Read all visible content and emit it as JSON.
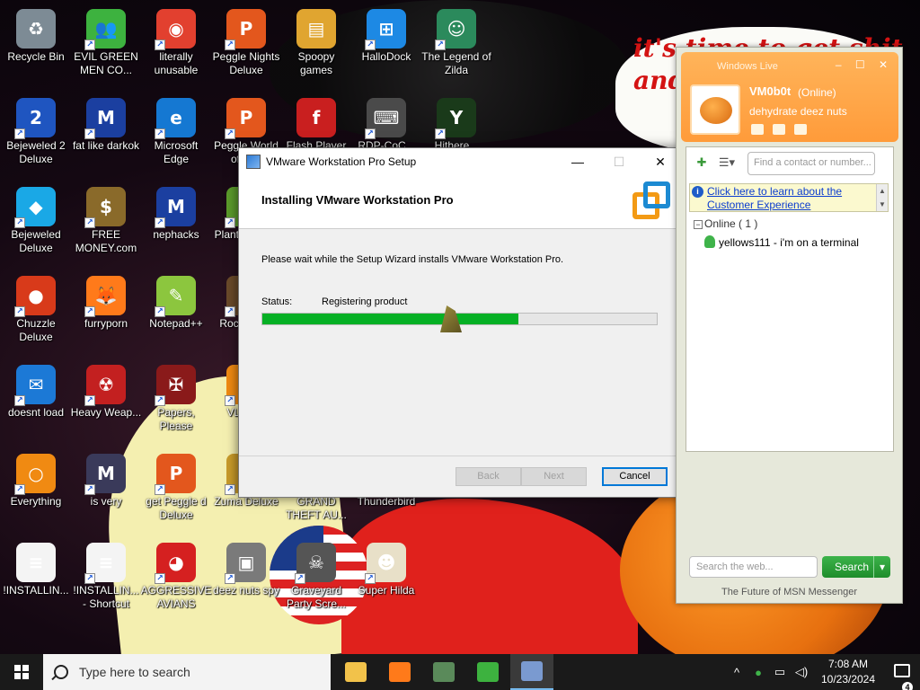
{
  "wallpaper": {
    "speech_text": "it's time to get shit and ... or t..."
  },
  "desktop_icons": [
    {
      "name": "recycle-bin-icon",
      "label": "Recycle Bin",
      "color": "#7d8b95",
      "glyph": "♻",
      "shortcut": false
    },
    {
      "name": "evil-green-men-icon",
      "label": "EVIL GREEN MEN CO...",
      "color": "#3db23f",
      "glyph": "👥",
      "shortcut": true
    },
    {
      "name": "chrome-icon",
      "label": "literally unusable",
      "color": "#e2402f",
      "glyph": "◉",
      "shortcut": true
    },
    {
      "name": "peggle-nights-icon",
      "label": "Peggle Nights Deluxe",
      "color": "#e3571d",
      "glyph": "P",
      "shortcut": true
    },
    {
      "name": "spoopy-games-icon",
      "label": "Spoopy games",
      "color": "#e0a530",
      "glyph": "▤",
      "shortcut": false
    },
    {
      "name": "hallodock-icon",
      "label": "HalloDock",
      "color": "#1d89e4",
      "glyph": "⊞",
      "shortcut": true
    },
    {
      "name": "zelda-icon",
      "label": "The Legend of Zilda",
      "color": "#2b8a5c",
      "glyph": "☺",
      "shortcut": true
    },
    {
      "name": "bejeweled2-icon",
      "label": "Bejeweled 2 Deluxe",
      "color": "#1f55c0",
      "glyph": "2",
      "shortcut": true
    },
    {
      "name": "mpl-icon",
      "label": "fat like darkok",
      "color": "#1b3fa0",
      "glyph": "M",
      "shortcut": true
    },
    {
      "name": "edge-icon",
      "label": "Microsoft Edge",
      "color": "#1578d2",
      "glyph": "e",
      "shortcut": true
    },
    {
      "name": "peggle-world-icon",
      "label": "Peggle World of W...",
      "color": "#e3571d",
      "glyph": "P",
      "shortcut": true
    },
    {
      "name": "flash-icon",
      "label": "Flash Player",
      "color": "#c91f1f",
      "glyph": "f",
      "shortcut": false
    },
    {
      "name": "rdp-icon",
      "label": "RDP-CoC...",
      "color": "#4a4a4a",
      "glyph": "⌨",
      "shortcut": true
    },
    {
      "name": "yashma-icon",
      "label": "Hithere...",
      "color": "#1a3a1a",
      "glyph": "Y",
      "shortcut": true
    },
    {
      "name": "bejeweled-icon",
      "label": "Bejeweled Deluxe",
      "color": "#1aa8e6",
      "glyph": "◆",
      "shortcut": true
    },
    {
      "name": "free-money-icon",
      "label": "FREE MONEY.com",
      "color": "#8a6a2a",
      "glyph": "$",
      "shortcut": true
    },
    {
      "name": "nephacks-icon",
      "label": "nephacks",
      "color": "#1b3fa0",
      "glyph": "M",
      "shortcut": true
    },
    {
      "name": "plants-zombies-icon",
      "label": "Plants Zom...",
      "color": "#5b9b2b",
      "glyph": "✿",
      "shortcut": true
    },
    {
      "name": "chuzzle-icon",
      "label": "Chuzzle Deluxe",
      "color": "#d83a1a",
      "glyph": "●",
      "shortcut": true
    },
    {
      "name": "firefox-icon",
      "label": "furryporn",
      "color": "#ff7a1a",
      "glyph": "🦊",
      "shortcut": true
    },
    {
      "name": "notepadpp-icon",
      "label": "Notepad++",
      "color": "#8cc63e",
      "glyph": "✎",
      "shortcut": true
    },
    {
      "name": "rocket-icon",
      "label": "Rock... D...",
      "color": "#6a4a2a",
      "glyph": "▲",
      "shortcut": true
    },
    {
      "name": "thunderbird-blue-icon",
      "label": "doesnt load",
      "color": "#1c79d6",
      "glyph": "✉",
      "shortcut": true
    },
    {
      "name": "heavy-weapon-icon",
      "label": "Heavy Weap...",
      "color": "#c32020",
      "glyph": "☢",
      "shortcut": true
    },
    {
      "name": "papers-please-icon",
      "label": "Papers, Please",
      "color": "#8a1a1a",
      "glyph": "✠",
      "shortcut": true
    },
    {
      "name": "vlc-icon",
      "label": "VLC p...",
      "color": "#f08a12",
      "glyph": "▲",
      "shortcut": true
    },
    {
      "name": "everything-icon",
      "label": "Everything",
      "color": "#f08a12",
      "glyph": "○",
      "shortcut": true
    },
    {
      "name": "mpl-shield-icon",
      "label": "is very",
      "color": "#3a3a5a",
      "glyph": "M",
      "shortcut": true
    },
    {
      "name": "get-peggle-icon",
      "label": "get Peggle d Deluxe",
      "color": "#e3571d",
      "glyph": "P",
      "shortcut": true
    },
    {
      "name": "zuma-icon",
      "label": "Zuma Deluxe",
      "color": "#c89a2a",
      "glyph": "◎",
      "shortcut": true
    },
    {
      "name": "gta-icon",
      "label": "GRAND THEFT AU...",
      "color": "#333333",
      "glyph": "G",
      "shortcut": true
    },
    {
      "name": "thunderbird-icon",
      "label": "Thunderbird",
      "color": "#2a6ad0",
      "glyph": "✉",
      "shortcut": true
    },
    {
      "name": "installing-doc-icon",
      "label": "!INSTALLIN...",
      "color": "#f4f4f4",
      "glyph": "≡",
      "shortcut": false
    },
    {
      "name": "installing-shortcut-icon",
      "label": "!INSTALLIN... - Shortcut",
      "color": "#f4f4f4",
      "glyph": "≡",
      "shortcut": true
    },
    {
      "name": "angry-birds-icon",
      "label": "AGGRESSIVE AVIANS",
      "color": "#d52020",
      "glyph": "◕",
      "shortcut": true
    },
    {
      "name": "deez-nuts-spy-icon",
      "label": "deez nuts spy",
      "color": "#7a7a7a",
      "glyph": "▣",
      "shortcut": true
    },
    {
      "name": "graveyard-icon",
      "label": "Graveyard Party Scre...",
      "color": "#555555",
      "glyph": "☠",
      "shortcut": true
    },
    {
      "name": "super-hilda-icon",
      "label": "Super Hilda",
      "color": "#e8e0c8",
      "glyph": "☻",
      "shortcut": true
    }
  ],
  "setup": {
    "title": "VMware Workstation Pro Setup",
    "heading": "Installing VMware Workstation Pro",
    "description": "Please wait while the Setup Wizard installs VMware Workstation Pro.",
    "status_label": "Status:",
    "status_value": "Registering product",
    "progress_fraction": 0.65,
    "progress_color": "#06b025",
    "back_label": "Back",
    "next_label": "Next",
    "cancel_label": "Cancel",
    "minimize": "—",
    "maximize": "☐",
    "close": "✕"
  },
  "msn": {
    "window_title": "Windows Live",
    "username": "VM0b0t",
    "status": "(Online)",
    "personal_message": "dehydrate deez nuts",
    "find_placeholder": "Find a contact or number...",
    "notice_link": "Click here to learn about the Customer Experience",
    "group_label": "Online ( 1 )",
    "contacts": [
      {
        "text": "yellows111 - i'm on a terminal"
      }
    ],
    "search_placeholder": "Search the web...",
    "search_button": "Search",
    "footer": "The Future of MSN Messenger",
    "accent": "#ff9b3a"
  },
  "taskbar": {
    "search_placeholder": "Type here to search",
    "apps": [
      {
        "name": "file-explorer-taskbar-icon",
        "color": "#f2c24a",
        "active": false
      },
      {
        "name": "firefox-taskbar-icon",
        "color": "#ff7a1a",
        "active": false
      },
      {
        "name": "app-window-taskbar-icon",
        "color": "#5a8a5a",
        "active": false
      },
      {
        "name": "messenger-taskbar-icon",
        "color": "#3db23f",
        "active": false
      },
      {
        "name": "installer-taskbar-icon",
        "color": "#7a9ad0",
        "active": true
      }
    ],
    "time": "7:08 AM",
    "date": "10/23/2024",
    "notification_count": "4"
  }
}
